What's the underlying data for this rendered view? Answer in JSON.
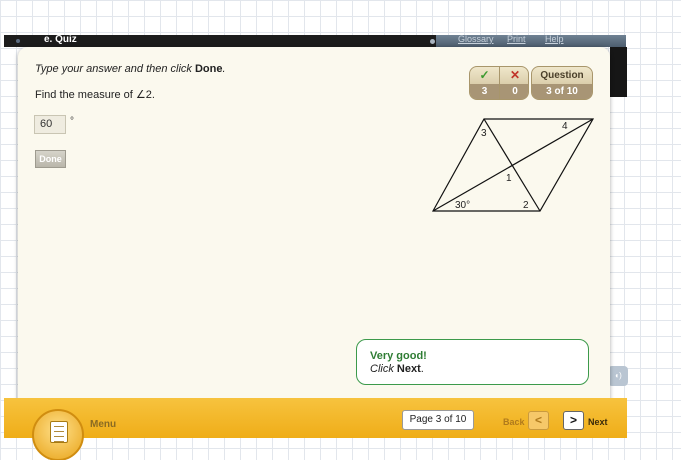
{
  "app": {
    "title": "e. Quiz"
  },
  "topnav": {
    "glossary": "Glossary",
    "print": "Print",
    "help": "Help"
  },
  "content": {
    "instruction_prefix": "Type your answer and then click ",
    "instruction_bold": "Done",
    "instruction_suffix": ".",
    "question": "Find the measure of ∠2.",
    "answer_value": "60",
    "degree_symbol": "°",
    "done_label": "Done"
  },
  "score": {
    "correct_icon": "✓",
    "correct_count": "3",
    "wrong_icon": "✕",
    "wrong_count": "0",
    "question_label": "Question",
    "question_progress": "3 of 10"
  },
  "diagram": {
    "labels": {
      "angle1": "1",
      "angle2": "2",
      "angle3": "3",
      "angle4": "4",
      "given_angle": "30°"
    }
  },
  "feedback": {
    "title": "Very good!",
    "click": "Click",
    "next": "Next",
    "period": "."
  },
  "footer": {
    "menu_label": "Menu",
    "page_indicator": "Page 3 of 10",
    "back_label": "Back",
    "next_label": "Next",
    "back_arrow": "<",
    "next_arrow": ">"
  },
  "colors": {
    "panel_bg": "#fbf9ee",
    "accent_orange": "#efad18",
    "feedback_green": "#3c9a4b"
  }
}
